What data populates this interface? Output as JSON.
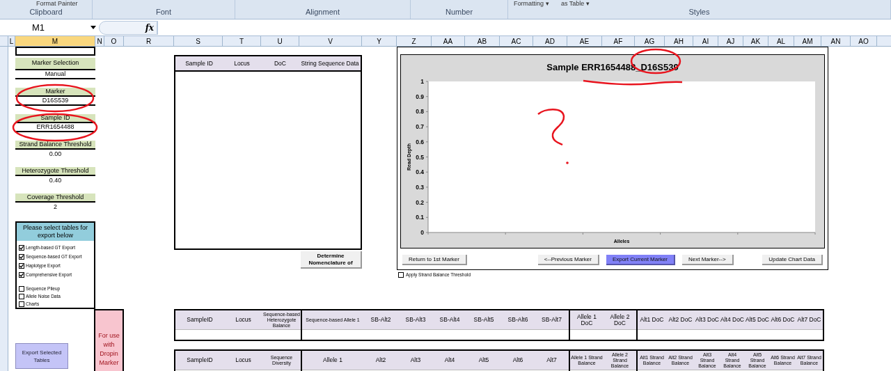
{
  "ribbon": {
    "items": [
      "Format Painter",
      "Formatting ▾",
      "as Table ▾"
    ],
    "groups": [
      "Clipboard",
      "Font",
      "Alignment",
      "Number",
      "Styles"
    ]
  },
  "name_box": "M1",
  "function_label": "fx",
  "columns": [
    {
      "label": "L",
      "selected": false
    },
    {
      "label": "M",
      "selected": true
    },
    {
      "label": "N",
      "selected": false
    },
    {
      "label": "O",
      "selected": false
    },
    {
      "label": "R",
      "selected": false
    },
    {
      "label": "S",
      "selected": false
    },
    {
      "label": "T",
      "selected": false
    },
    {
      "label": "U",
      "selected": false
    },
    {
      "label": "V",
      "selected": false
    },
    {
      "label": "Y",
      "selected": false
    },
    {
      "label": "Z",
      "selected": false
    },
    {
      "label": "AA",
      "selected": false
    },
    {
      "label": "AB",
      "selected": false
    },
    {
      "label": "AC",
      "selected": false
    },
    {
      "label": "AD",
      "selected": false
    },
    {
      "label": "AE",
      "selected": false
    },
    {
      "label": "AF",
      "selected": false
    },
    {
      "label": "AG",
      "selected": false
    },
    {
      "label": "AH",
      "selected": false
    },
    {
      "label": "AI",
      "selected": false
    },
    {
      "label": "AJ",
      "selected": false
    },
    {
      "label": "AK",
      "selected": false
    },
    {
      "label": "AL",
      "selected": false
    },
    {
      "label": "AM",
      "selected": false
    },
    {
      "label": "AN",
      "selected": false
    },
    {
      "label": "AO",
      "selected": false
    }
  ],
  "settings": [
    {
      "kind": "selection",
      "label": "Marker Selection",
      "value": "Manual"
    },
    {
      "kind": "selection",
      "label": "Marker",
      "value": "D16S539"
    },
    {
      "kind": "selection",
      "label": "Sample ID",
      "value": "ERR1654488"
    },
    {
      "kind": "threshold",
      "label": "Strand Balance Threshold",
      "value": "0.00"
    },
    {
      "kind": "threshold",
      "label": "Heterozygote Threshold",
      "value": "0.40"
    },
    {
      "kind": "threshold",
      "label": "Coverage Threshold",
      "value": "2"
    }
  ],
  "export_panel": {
    "title": "Please select tables for export below",
    "option_groups": [
      [
        {
          "label": "Length-based GT Export",
          "checked": true
        },
        {
          "label": "Sequence-based GT Export",
          "checked": true
        },
        {
          "label": "Haplotype Export",
          "checked": true
        },
        {
          "label": "Comprehensive Export",
          "checked": true
        }
      ],
      [
        {
          "label": "Sequence Pileup",
          "checked": false
        },
        {
          "label": "Allele Noise Data",
          "checked": false
        },
        {
          "label": "Charts",
          "checked": false
        }
      ]
    ]
  },
  "export_button": "Export Selected Tables",
  "dropin_note": "For use with Dropin Marker",
  "sequence_table": {
    "columns": [
      "Sample ID",
      "Locus",
      "DoC",
      "String Sequence Data"
    ]
  },
  "nomenclature_button": "Determine Nomenclature of",
  "chart": {
    "chart_data": {
      "type": "bar",
      "title": "Sample ERR1654488_D16S539",
      "xlabel": "Alleles",
      "ylabel": "Read Depth",
      "categories": [
        null,
        null,
        null,
        null,
        null
      ],
      "values": [
        null,
        null,
        null,
        null,
        null
      ],
      "ylim": [
        0,
        1
      ],
      "yticks": [
        {
          "value": 0,
          "label": "0"
        },
        {
          "value": 0.1,
          "label": "0.1"
        },
        {
          "value": 0.2,
          "label": "0.2"
        },
        {
          "value": 0.3,
          "label": "0.3"
        },
        {
          "value": 0.4,
          "label": "0.4"
        },
        {
          "value": 0.5,
          "label": "0.5"
        },
        {
          "value": 0.6,
          "label": "0.6"
        },
        {
          "value": 0.7,
          "label": "0.7"
        },
        {
          "value": 0.8,
          "label": "0.8"
        },
        {
          "value": 0.9,
          "label": "0.9"
        },
        {
          "value": 1,
          "label": "1"
        }
      ]
    }
  },
  "chart_buttons": [
    {
      "label": "Return to 1st Marker",
      "highlighted": false
    },
    {
      "label": "<--Previous Marker",
      "highlighted": false
    },
    {
      "label": "Export Current Marker",
      "highlighted": true
    },
    {
      "label": "Next Marker-->",
      "highlighted": false
    },
    {
      "label": "Update Chart Data",
      "highlighted": false
    }
  ],
  "strand_balance_option": {
    "label": "Apply Strand Balance Threshold",
    "checked": false
  },
  "result_tables": [
    {
      "sections": [
        [
          "SampleID",
          "Locus",
          "Sequence-based Heterozygote Balance"
        ],
        [
          "Sequence-based Allele 1",
          "SB-Alt2",
          "SB-Alt3",
          "SB-Alt4",
          "SB-Alt5",
          "SB-Alt6",
          "SB-Alt7"
        ],
        [
          "Allele 1 DoC",
          "Allele 2 DoC"
        ],
        [
          "Alt1 DoC",
          "Alt2 DoC",
          "Alt3 DoC",
          "Alt4 DoC",
          "Alt5 DoC",
          "Alt6 DoC",
          "Alt7 DoC"
        ]
      ]
    },
    {
      "sections": [
        [
          "SampleID",
          "Locus",
          "Sequence Diversity"
        ],
        [
          "Allele 1",
          "Alt2",
          "Alt3",
          "Alt4",
          "Alt5",
          "Alt6",
          "Alt7"
        ],
        [
          "Allele 1 Strand Balance",
          "Allele 2 Strand Balance"
        ],
        [
          "Alt1 Strand Balance",
          "Alt2 Strand Balance",
          "Alt3 Strand Balance",
          "Alt4 Strand Balance",
          "Alt5 Strand Balance",
          "Alt6 Strand Balance",
          "Alt7 Strand Balance"
        ]
      ]
    }
  ]
}
